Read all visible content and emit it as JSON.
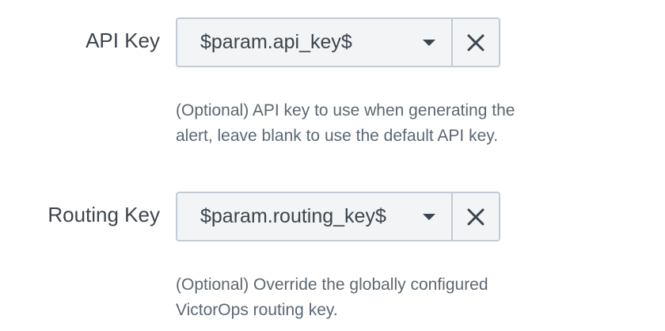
{
  "fields": [
    {
      "label": "API Key",
      "value": "$param.api_key$",
      "help": "(Optional) API key to use when generating the alert, leave blank to use the default API key.",
      "select_icon": "caret-down-icon",
      "clear_icon": "close-icon"
    },
    {
      "label": "Routing Key",
      "value": "$param.routing_key$",
      "help": "(Optional) Override the globally configured VictorOps routing key.",
      "select_icon": "caret-down-icon",
      "clear_icon": "close-icon"
    }
  ],
  "colors": {
    "text": "#3c444d",
    "help_text": "#5c6773",
    "control_bg": "#f2f4f5",
    "control_border": "#c3cbd4"
  }
}
